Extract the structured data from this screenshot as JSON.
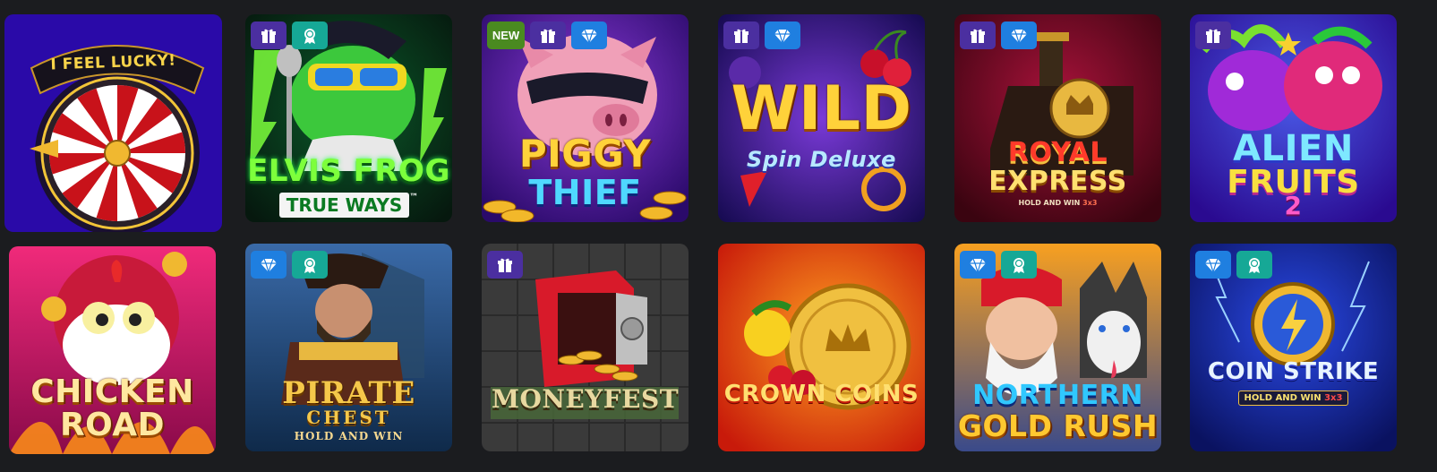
{
  "games": [
    {
      "id": "lucky",
      "title": "I FEEL LUCKY!",
      "badges": []
    },
    {
      "id": "elvis",
      "title": "ELVIS FROG",
      "subtitle": "TRUE WAYS",
      "tm": "™",
      "badges": [
        "gift-icon",
        "award-icon"
      ]
    },
    {
      "id": "piggy",
      "title_line1": "PIGGY",
      "title_line2": "THIEF",
      "new_label": "NEW",
      "badges": [
        "new",
        "gift-icon",
        "diamond-icon"
      ]
    },
    {
      "id": "wild",
      "title": "WILD",
      "subtitle": "Spin Deluxe",
      "badges": [
        "gift-icon",
        "diamond-icon"
      ]
    },
    {
      "id": "royal",
      "title_line1": "ROYAL",
      "title_line2": "EXPRESS",
      "subtitle": "HOLD AND WIN",
      "tag": "3x3",
      "badges": [
        "gift-icon",
        "diamond-icon"
      ]
    },
    {
      "id": "alien",
      "title_line1": "ALIEN",
      "title_line2": "FRUITS",
      "tag": "2",
      "badges": [
        "gift-icon"
      ]
    },
    {
      "id": "chicken",
      "title_line1": "CHICKEN",
      "title_line2": "ROAD",
      "badges": []
    },
    {
      "id": "pirate",
      "title_line1": "PIRATE",
      "title_line2": "CHEST",
      "subtitle": "HOLD AND WIN",
      "badges": [
        "diamond-icon",
        "award-icon"
      ]
    },
    {
      "id": "moneyfest",
      "title": "MONEYFEST",
      "badges": [
        "gift-icon"
      ]
    },
    {
      "id": "crown",
      "title": "CROWN COINS",
      "badges": []
    },
    {
      "id": "northern",
      "title_line1": "NORTHERN",
      "title_line2": "GOLD RUSH",
      "badges": [
        "diamond-icon",
        "award-icon"
      ]
    },
    {
      "id": "coin",
      "title": "COIN STRIKE",
      "subtitle": "HOLD AND WIN",
      "tag": "3x3",
      "badges": [
        "diamond-icon",
        "award-icon"
      ]
    }
  ],
  "colors": {
    "page_bg": "#1b1c1f",
    "gift_badge": "#4b2fa0",
    "diamond_badge": "#1f7fe0",
    "award_badge": "#16a896",
    "new_badge": "#4a8a20"
  }
}
